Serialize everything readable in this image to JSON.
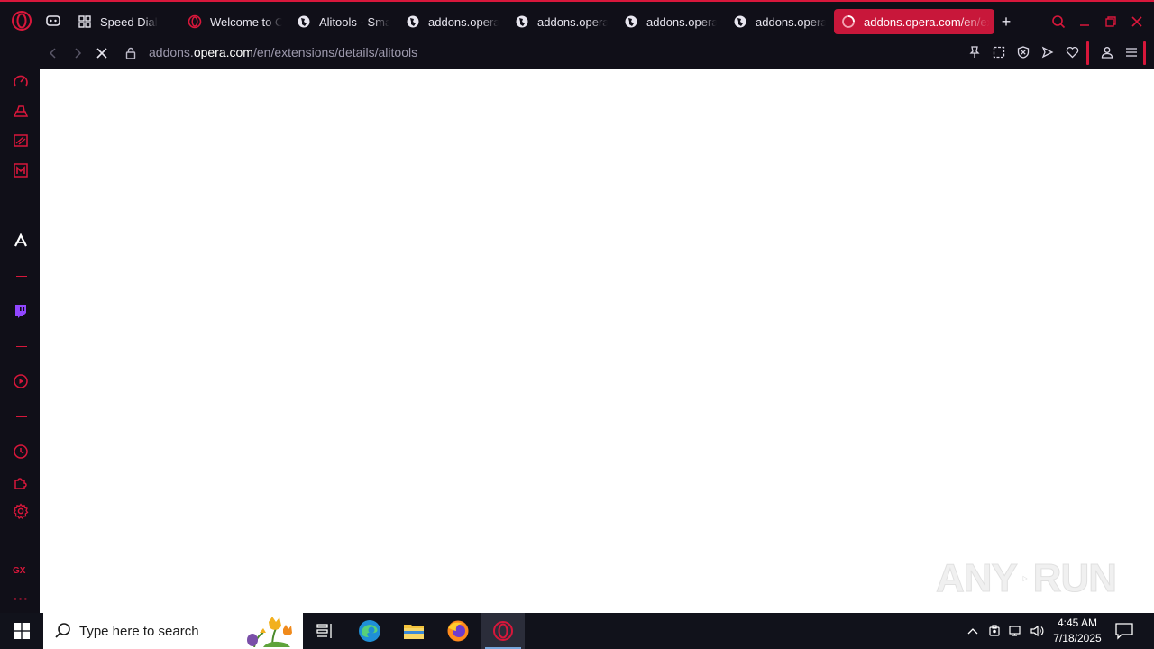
{
  "tabs": [
    {
      "label": "Speed Dial",
      "icon": "speed-dial-icon"
    },
    {
      "label": "Welcome to Opera",
      "icon": "opera-icon"
    },
    {
      "label": "Alitools - Smart",
      "icon": "globe-icon"
    },
    {
      "label": "addons.opera.com",
      "icon": "globe-icon"
    },
    {
      "label": "addons.opera.com",
      "icon": "globe-icon"
    },
    {
      "label": "addons.opera.com",
      "icon": "globe-icon"
    },
    {
      "label": "addons.opera.com",
      "icon": "globe-icon"
    },
    {
      "label": "addons.opera.com/en/extensions",
      "icon": "loading-spinner-icon",
      "active": true
    }
  ],
  "address": {
    "prefix": "addons.",
    "host": "opera.com",
    "path": "/en/extensions/details/alitools"
  },
  "sidebar": {
    "gx_label": "GX",
    "more_label": "···"
  },
  "watermark": {
    "left": "ANY",
    "right": "RUN"
  },
  "taskbar": {
    "search_placeholder": "Type here to search",
    "time": "4:45 AM",
    "date": "7/18/2025"
  },
  "colors": {
    "accent": "#d8173b",
    "tab_active": "#c8173a",
    "chrome_bg": "#100f18",
    "taskbar_bg": "#11121b"
  }
}
